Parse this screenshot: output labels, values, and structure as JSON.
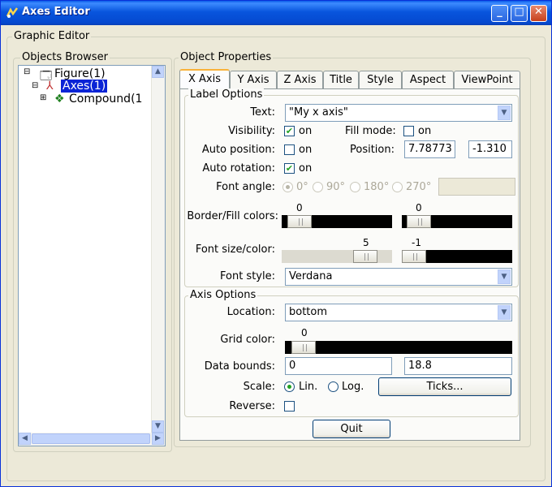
{
  "window": {
    "title": "Axes Editor",
    "minimize": "_",
    "maximize": "□",
    "close": "✕"
  },
  "graphic_editor_label": "Graphic Editor",
  "objects_browser": {
    "label": "Objects Browser",
    "nodes": [
      {
        "label": "Figure(1)"
      },
      {
        "label": "Axes(1)"
      },
      {
        "label": "Compound(1"
      }
    ]
  },
  "object_properties_label": "Object Properties",
  "tabs": [
    {
      "label": "X Axis",
      "active": true
    },
    {
      "label": "Y Axis"
    },
    {
      "label": "Z Axis"
    },
    {
      "label": "Title"
    },
    {
      "label": "Style"
    },
    {
      "label": "Aspect"
    },
    {
      "label": "ViewPoint"
    }
  ],
  "label_options": {
    "label": "Label Options",
    "text_label": "Text:",
    "text_value": "\"My x axis\"",
    "visibility_label": "Visibility:",
    "visibility_checked": true,
    "on": "on",
    "fill_mode_label": "Fill mode:",
    "fill_mode_checked": false,
    "auto_position_label": "Auto position:",
    "auto_position_checked": false,
    "position_label": "Position:",
    "position_x": "7.78773",
    "position_y": "-1.310",
    "auto_rotation_label": "Auto rotation:",
    "auto_rotation_checked": true,
    "font_angle_label": "Font angle:",
    "font_angles": [
      "0°",
      "90°",
      "180°",
      "270°"
    ],
    "border_fill_label": "Border/Fill colors:",
    "border_color_value": "0",
    "fill_color_value": "0",
    "font_size_color_label": "Font size/color:",
    "font_size_value": "5",
    "font_color_value": "-1",
    "font_style_label": "Font style:",
    "font_style_value": "Verdana"
  },
  "axis_options": {
    "label": "Axis Options",
    "location_label": "Location:",
    "location_value": "bottom",
    "grid_color_label": "Grid color:",
    "grid_color_value": "0",
    "data_bounds_label": "Data bounds:",
    "data_bounds_min": "0",
    "data_bounds_max": "18.8",
    "scale_label": "Scale:",
    "scale_lin": "Lin.",
    "scale_log": "Log.",
    "scale_selected": "Lin.",
    "ticks_button": "Ticks...",
    "reverse_label": "Reverse:",
    "reverse_checked": false
  },
  "quit_button": "Quit",
  "colors": {
    "titlebar": "#0a5ce8",
    "selection": "#0a24d6",
    "check": "#21a121"
  }
}
